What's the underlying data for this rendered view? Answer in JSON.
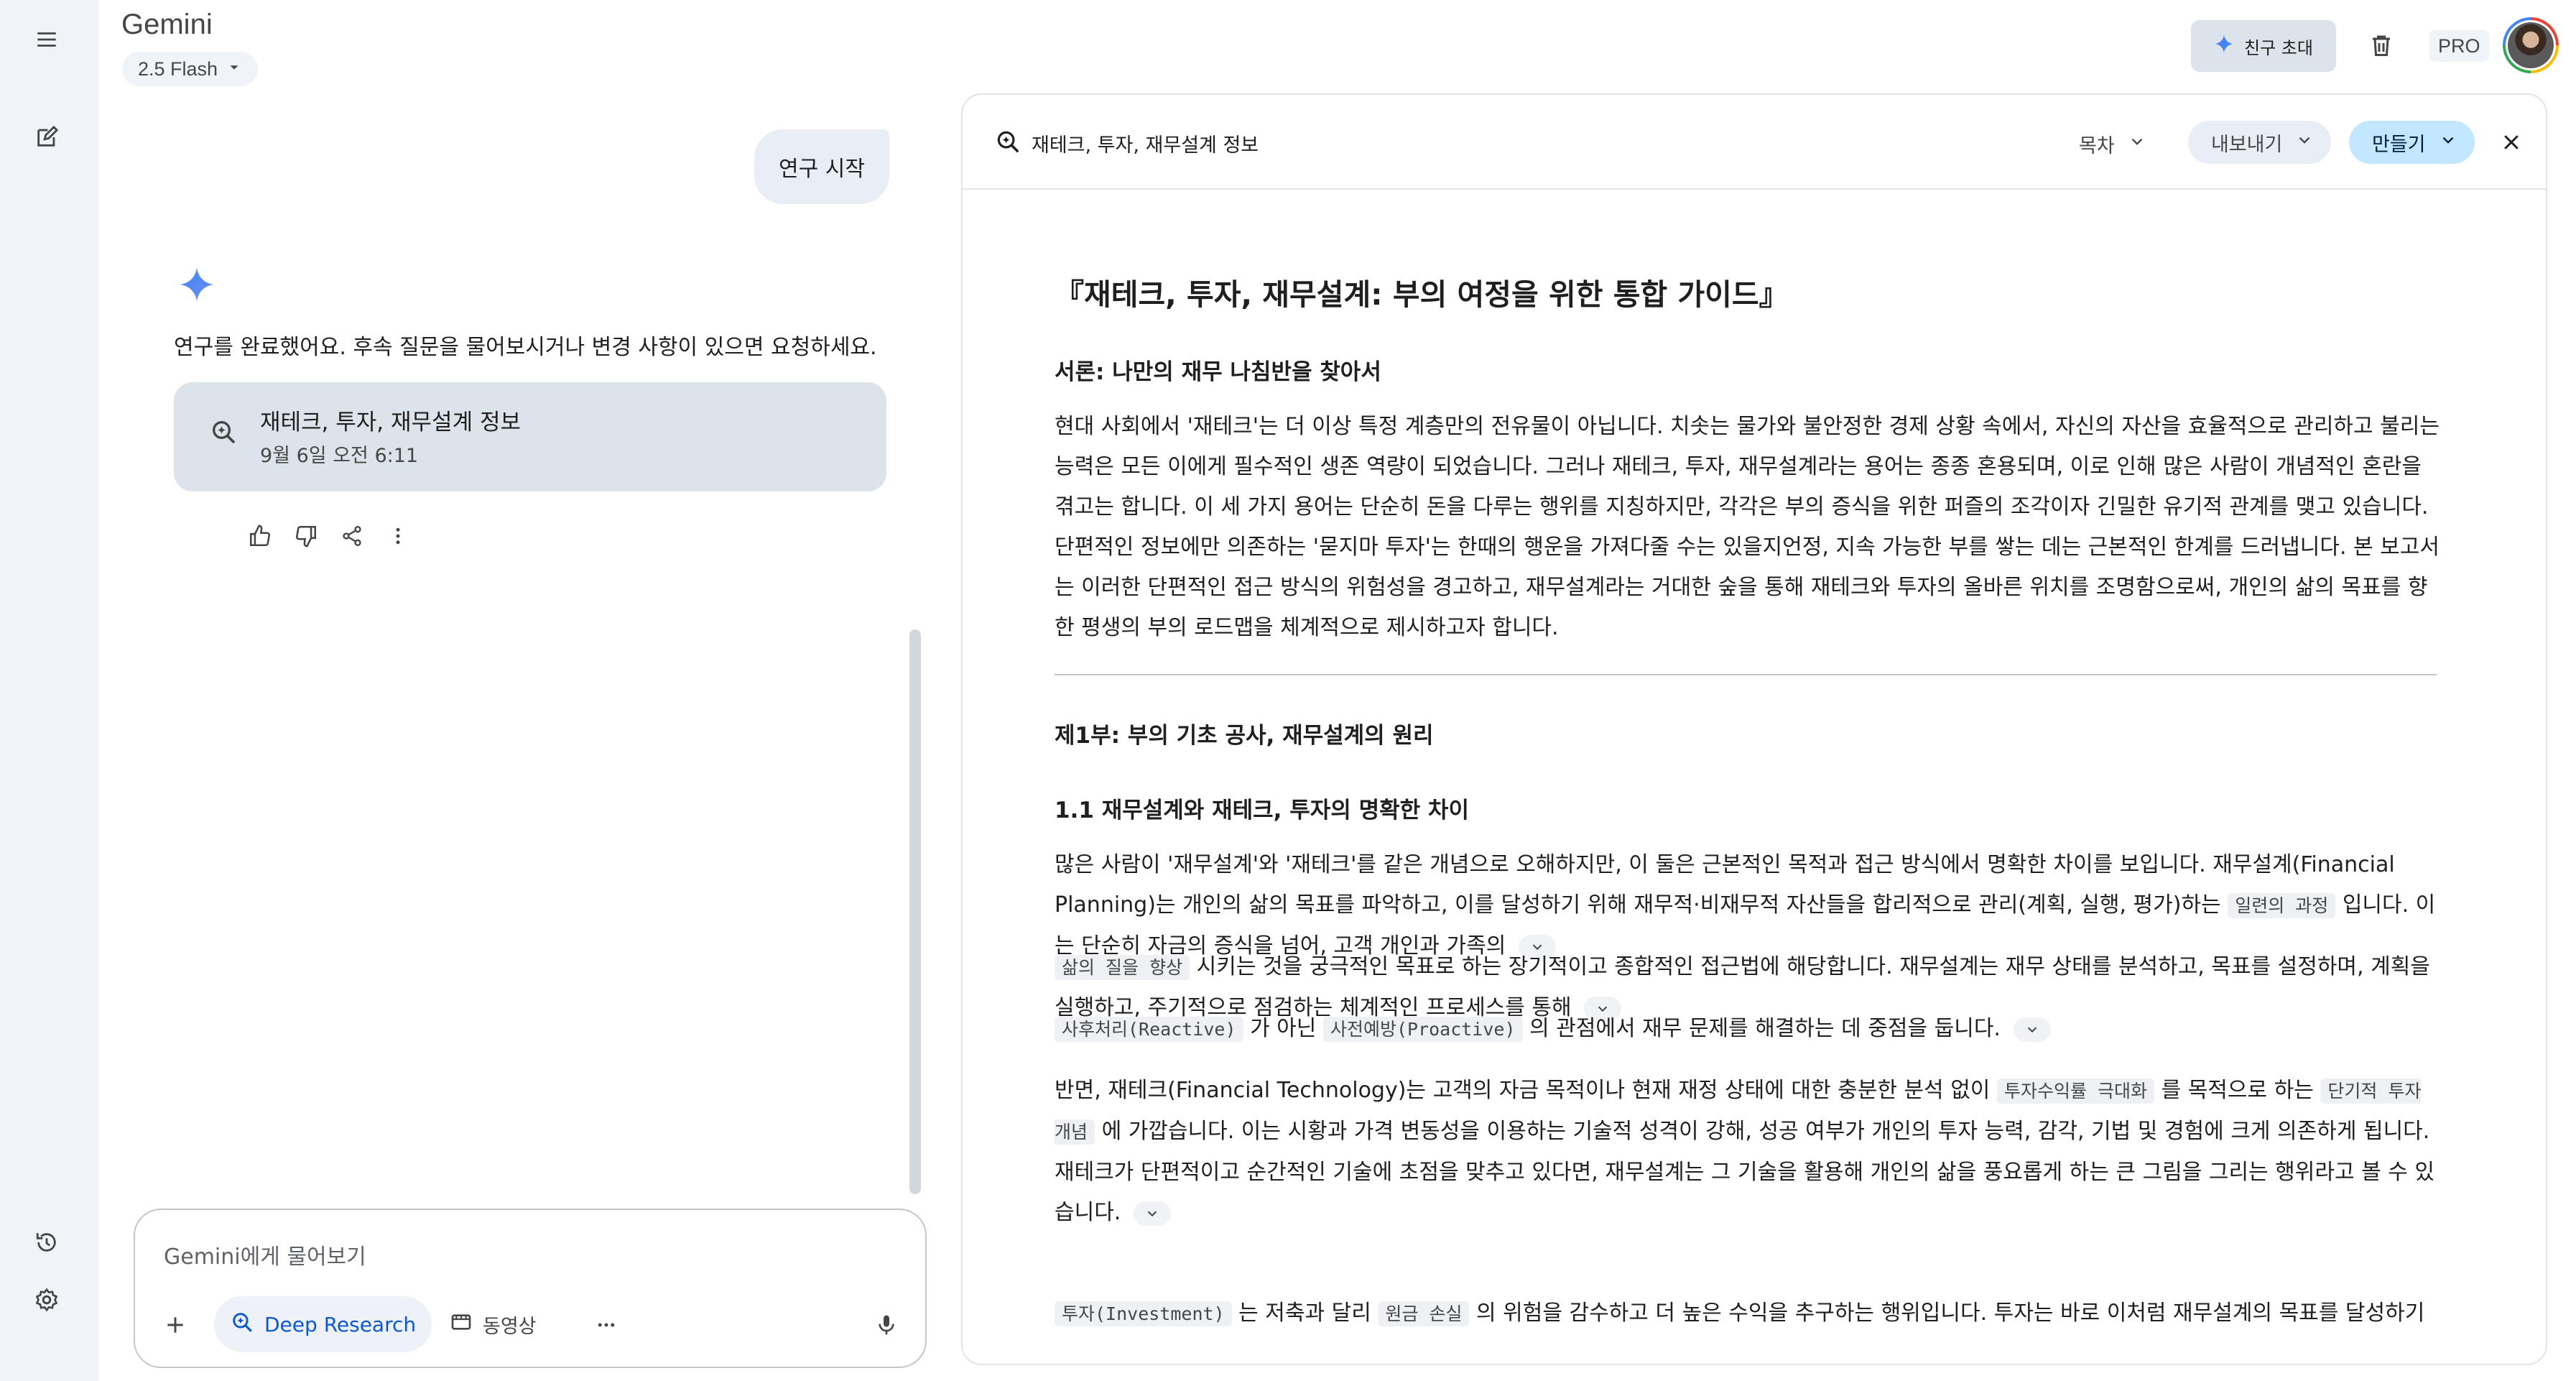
{
  "app": {
    "brand": "Gemini",
    "model": "2.5 Flash",
    "invite_label": "친구 초대",
    "pro_label": "PRO"
  },
  "chat": {
    "user_message": "연구 시작",
    "assistant_message": "연구를 완료했어요. 후속 질문을 물어보시거나 변경 사항이 있으면 요청하세요.",
    "report_card": {
      "title": "재테크, 투자, 재무설계 정보",
      "date": "9월 6일 오전 6:11"
    },
    "input_placeholder": "Gemini에게 물어보기",
    "tools": {
      "deep_research": "Deep Research",
      "video": "동영상"
    }
  },
  "doc": {
    "header_title": "재테크, 투자, 재무설계 정보",
    "toc_label": "목차",
    "export_label": "내보내기",
    "create_label": "만들기",
    "title": "『재테크, 투자, 재무설계: 부의 여정을 위한 통합 가이드』",
    "intro_heading": "서론: 나만의 재무 나침반을 찾아서",
    "intro_text": "현대 사회에서 '재테크'는 더 이상 특정 계층만의 전유물이 아닙니다. 치솟는 물가와 불안정한 경제 상황 속에서, 자신의 자산을 효율적으로 관리하고 불리는 능력은 모든 이에게 필수적인 생존 역량이 되었습니다. 그러나 재테크, 투자, 재무설계라는 용어는 종종 혼용되며, 이로 인해 많은 사람이 개념적인 혼란을 겪고는 합니다. 이 세 가지 용어는 단순히 돈을 다루는 행위를 지칭하지만, 각각은 부의 증식을 위한 퍼즐의 조각이자 긴밀한 유기적 관계를 맺고 있습니다. 단편적인 정보에만 의존하는 '묻지마 투자'는 한때의 행운을 가져다줄 수는 있을지언정, 지속 가능한 부를 쌓는 데는 근본적인 한계를 드러냅니다. 본 보고서는 이러한 단편적인 접근 방식의 위험성을 경고하고, 재무설계라는 거대한 숲을 통해 재테크와 투자의 올바른 위치를 조명함으로써, 개인의 삶의 목표를 향한 평생의 부의 로드맵을 체계적으로 제시하고자 합니다.",
    "part1_heading": "제1부: 부의 기초 공사, 재무설계의 원리",
    "sec11_heading": "1.1 재무설계와 재테크, 투자의 명확한 차이",
    "p1_text": "많은 사람이 '재무설계'와 '재테크'를 같은 개념으로 오해하지만, 이 둘은 근본적인 목적과 접근 방식에서 명확한 차이를 보입니다. 재무설계(Financial Planning)는 개인의 삶의 목표를 파악하고, 이를 달성하기 위해 재무적·비재무적 자산들을 합리적으로 관리(계획, 실행, 평가)하는",
    "p1_code": "일련의 과정",
    "p1_tail": "입니다. 이는 단순히 자금의 증식을 넘어, 고객 개인과 가족의",
    "p2_code": "삶의 질을 향상",
    "p2_text": "시키는 것을 궁극적인 목표로 하는 장기적이고 종합적인 접근법에 해당합니다. 재무설계는 재무 상태를 분석하고, 목표를 설정하며, 계획을 실행하고, 주기적으로 점검하는 체계적인 프로세스를 통해",
    "p3_code1": "사후처리(Reactive)",
    "p3_mid": "가 아닌",
    "p3_code2": "사전예방(Proactive)",
    "p3_text": "의 관점에서 재무 문제를 해결하는 데 중점을 둡니다.",
    "p4_lead": "반면, 재테크(Financial Technology)는 고객의 자금 목적이나 현재 재정 상태에 대한 충분한 분석 없이",
    "p4_code1": "투자수익률 극대화",
    "p4_mid": "를 목적으로 하는",
    "p4_code2": "단기적 투자 개념",
    "p4_text": "에 가깝습니다. 이는 시황과 가격 변동성을 이용하는 기술적 성격이 강해, 성공 여부가 개인의 투자 능력, 감각, 기법 및 경험에 크게 의존하게 됩니다. 재테크가 단편적이고 순간적인 기술에 초점을 맞추고 있다면, 재무설계는 그 기술을 활용해 개인의 삶을 풍요롭게 하는 큰 그림을 그리는 행위라고 볼 수 있습니다.",
    "p5_code1": "투자(Investment)",
    "p5_mid": "는 저축과 달리",
    "p5_code2": "원금 손실",
    "p5_text": "의 위험을 감수하고 더 높은 수익을 추구하는 행위입니다. 투자는 바로 이처럼 재무설계의 목표를 달성하기"
  },
  "colors": {
    "accent": "#0b57d0",
    "rail_bg": "#f0f4f9",
    "card_bg": "#dde3ea",
    "create_bg": "#c2e7ff"
  },
  "icons": [
    "menu-icon",
    "new-chat-icon",
    "history-icon",
    "settings-icon",
    "sparkle-icon",
    "trash-icon",
    "deep-research-icon",
    "thumbs-up-icon",
    "thumbs-down-icon",
    "share-icon",
    "more-vert-icon",
    "plus-icon",
    "video-icon",
    "more-horiz-icon",
    "mic-icon",
    "chevron-down-icon",
    "close-icon"
  ]
}
